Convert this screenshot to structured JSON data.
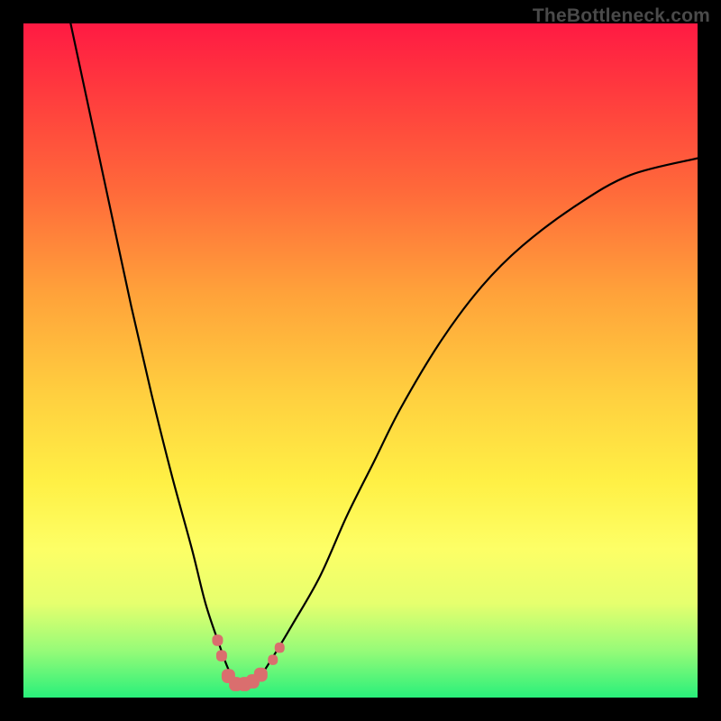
{
  "watermark": "TheBottleneck.com",
  "chart_data": {
    "type": "line",
    "title": "",
    "xlabel": "",
    "ylabel": "",
    "xlim": [
      0,
      100
    ],
    "ylim": [
      0,
      100
    ],
    "series": [
      {
        "name": "bottleneck-curve",
        "color": "#000000",
        "x": [
          7,
          10,
          13,
          16,
          19,
          22,
          25,
          27,
          29,
          30.5,
          32,
          33.5,
          35,
          37,
          40,
          44,
          48,
          52,
          56,
          62,
          68,
          74,
          82,
          90,
          100
        ],
        "y": [
          100,
          86,
          72,
          58,
          45,
          33,
          22,
          14,
          8,
          4,
          2,
          2,
          3,
          6,
          11,
          18,
          27,
          35,
          43,
          53,
          61,
          67,
          73,
          77.5,
          80
        ]
      }
    ],
    "markers": [
      {
        "name": "highlight-cluster",
        "color": "#da6e6e",
        "points": [
          {
            "x": 28.8,
            "y": 8.5,
            "size": 6
          },
          {
            "x": 29.4,
            "y": 6.2,
            "size": 6
          },
          {
            "x": 30.4,
            "y": 3.2,
            "size": 7.5
          },
          {
            "x": 31.5,
            "y": 2.0,
            "size": 7.5
          },
          {
            "x": 32.8,
            "y": 2.0,
            "size": 7.5
          },
          {
            "x": 34.0,
            "y": 2.4,
            "size": 7.5
          },
          {
            "x": 35.2,
            "y": 3.4,
            "size": 7.5
          },
          {
            "x": 37.0,
            "y": 5.6,
            "size": 5.5
          },
          {
            "x": 38.0,
            "y": 7.4,
            "size": 5.5
          }
        ]
      }
    ]
  }
}
